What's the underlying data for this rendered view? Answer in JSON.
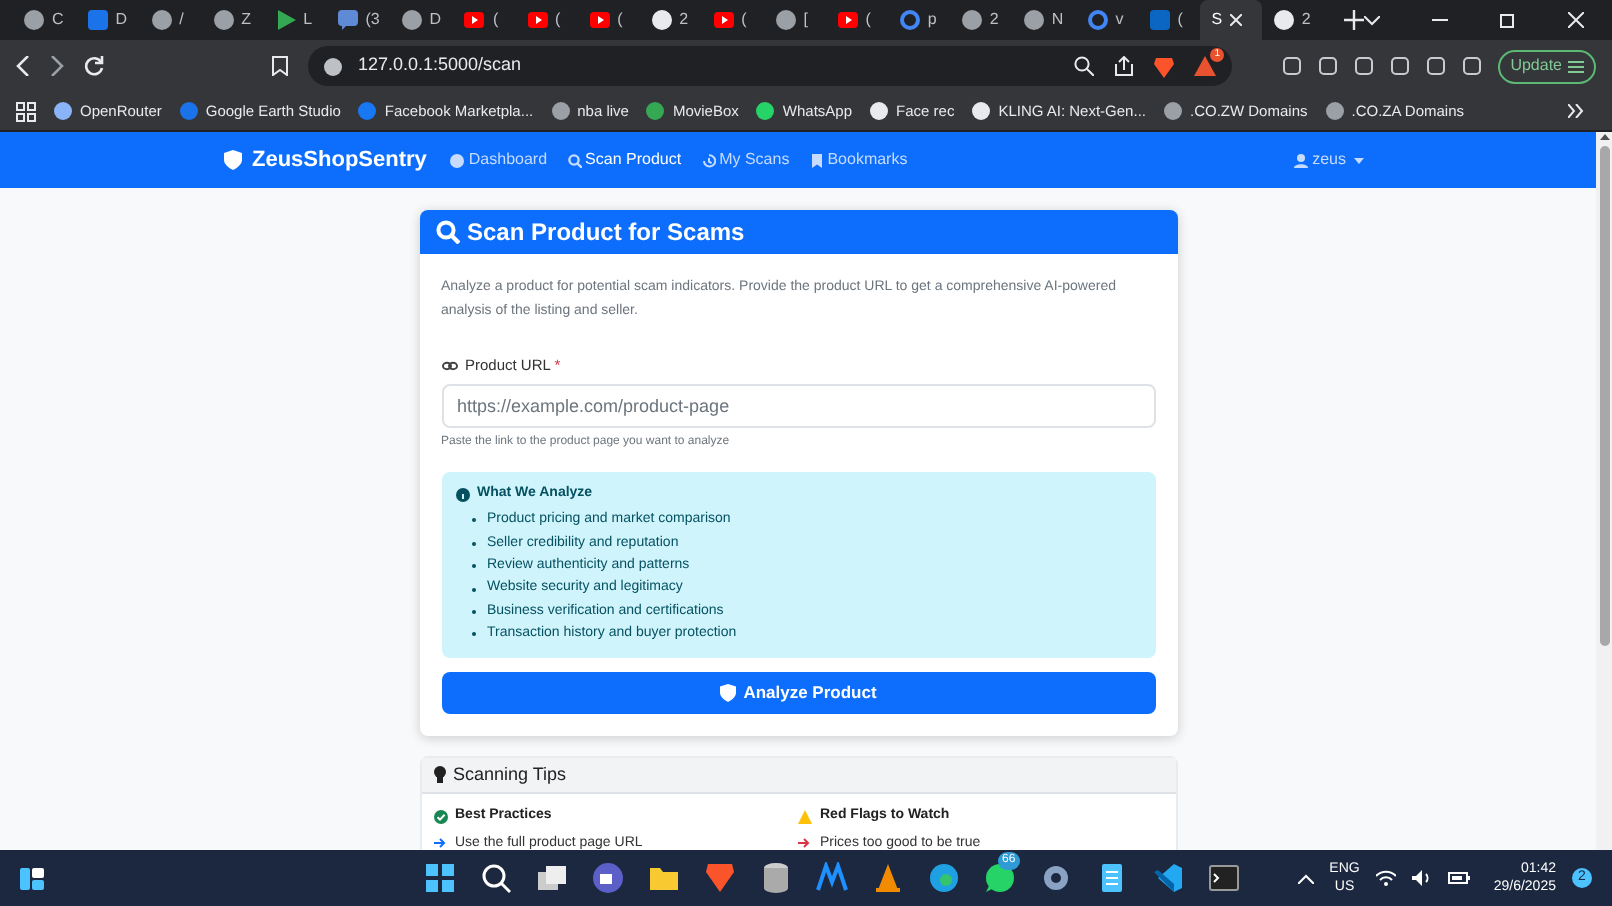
{
  "browser": {
    "tabs": [
      {
        "label": "C",
        "kind": "globe",
        "selected": false
      },
      {
        "label": "D",
        "kind": "letter",
        "selected": false
      },
      {
        "label": "/",
        "kind": "globe",
        "selected": false
      },
      {
        "label": "Z",
        "kind": "globe",
        "selected": false
      },
      {
        "label": "L",
        "kind": "play",
        "selected": false
      },
      {
        "label": "(3",
        "kind": "chat",
        "selected": false
      },
      {
        "label": "D",
        "kind": "globe",
        "selected": false
      },
      {
        "label": "(",
        "kind": "youtube",
        "selected": false
      },
      {
        "label": "(",
        "kind": "youtube",
        "selected": false
      },
      {
        "label": "(",
        "kind": "youtube",
        "selected": false
      },
      {
        "label": "2",
        "kind": "github",
        "selected": false
      },
      {
        "label": "(",
        "kind": "youtube",
        "selected": false
      },
      {
        "label": "[",
        "kind": "globe",
        "selected": false
      },
      {
        "label": "(",
        "kind": "youtube",
        "selected": false
      },
      {
        "label": "p",
        "kind": "google",
        "selected": false
      },
      {
        "label": "2",
        "kind": "globe",
        "selected": false
      },
      {
        "label": "N",
        "kind": "globe",
        "selected": false
      },
      {
        "label": "v",
        "kind": "google",
        "selected": false
      },
      {
        "label": "(",
        "kind": "linkedin",
        "selected": false
      },
      {
        "label": "S",
        "kind": "blank",
        "selected": true
      },
      {
        "label": "2",
        "kind": "github",
        "selected": false
      }
    ],
    "url": "127.0.0.1:5000/scan",
    "notification_count": "1",
    "update_label": "Update",
    "bookmarks": [
      "OpenRouter",
      "Google Earth Studio",
      "Facebook Marketpla...",
      "nba live",
      "MovieBox",
      "WhatsApp",
      "Face rec",
      "KLING AI: Next-Gen...",
      ".CO.ZW Domains",
      ".CO.ZA Domains"
    ]
  },
  "navbar": {
    "brand": "ZeusShopSentry",
    "links": [
      {
        "label": "Dashboard",
        "selected": false
      },
      {
        "label": "Scan Product",
        "selected": true
      },
      {
        "label": "My Scans",
        "selected": false
      },
      {
        "label": "Bookmarks",
        "selected": false
      }
    ],
    "user": "zeus"
  },
  "scan_card": {
    "title": "Scan Product for Scams",
    "description": "Analyze a product for potential scam indicators. Provide the product URL to get a comprehensive AI-powered analysis of the listing and seller.",
    "field_label": "Product URL",
    "required_mark": "*",
    "placeholder": "https://example.com/product-page",
    "hint": "Paste the link to the product page you want to analyze",
    "info_title": "What We Analyze",
    "info_items": [
      "Product pricing and market comparison",
      "Seller credibility and reputation",
      "Review authenticity and patterns",
      "Website security and legitimacy",
      "Business verification and certifications",
      "Transaction history and buyer protection"
    ],
    "button": "Analyze Product"
  },
  "tips_card": {
    "title": "Scanning Tips",
    "columns": [
      {
        "kind": "good",
        "heading": "Best Practices",
        "items": [
          "Use the full product page URL"
        ]
      },
      {
        "kind": "bad",
        "heading": "Red Flags to Watch",
        "items": [
          "Prices too good to be true"
        ]
      }
    ]
  },
  "taskbar": {
    "whatsapp_badge": "66",
    "language": "ENG",
    "region": "US",
    "time": "01:42",
    "date": "29/6/2025",
    "notification_count": "2"
  }
}
